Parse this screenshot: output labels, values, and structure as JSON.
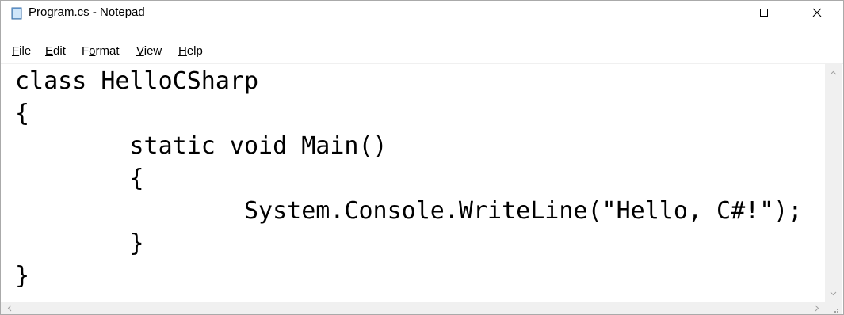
{
  "window": {
    "title": "Program.cs - Notepad",
    "icons": {
      "app": "notepad-icon",
      "minimize": "minimize-icon",
      "maximize": "maximize-icon",
      "close": "close-icon"
    }
  },
  "menu": {
    "items": [
      {
        "accel": "F",
        "rest": "ile"
      },
      {
        "accel": "E",
        "rest": "dit"
      },
      {
        "pre": "F",
        "accel": "o",
        "rest": "rmat"
      },
      {
        "accel": "V",
        "rest": "iew"
      },
      {
        "accel": "H",
        "rest": "elp"
      }
    ]
  },
  "editor": {
    "lines": [
      "class HelloCSharp",
      "{",
      "        static void Main()",
      "        {",
      "                System.Console.WriteLine(\"Hello, C#!\");",
      "        }",
      "}"
    ]
  },
  "scrollbars": {
    "icons": [
      "scroll-up-icon",
      "scroll-down-icon",
      "scroll-left-icon",
      "scroll-right-icon",
      "size-grip-icon"
    ]
  },
  "colors": {
    "chrome": "#f0f0f0",
    "text": "#000000",
    "border": "#aaaaaa"
  }
}
